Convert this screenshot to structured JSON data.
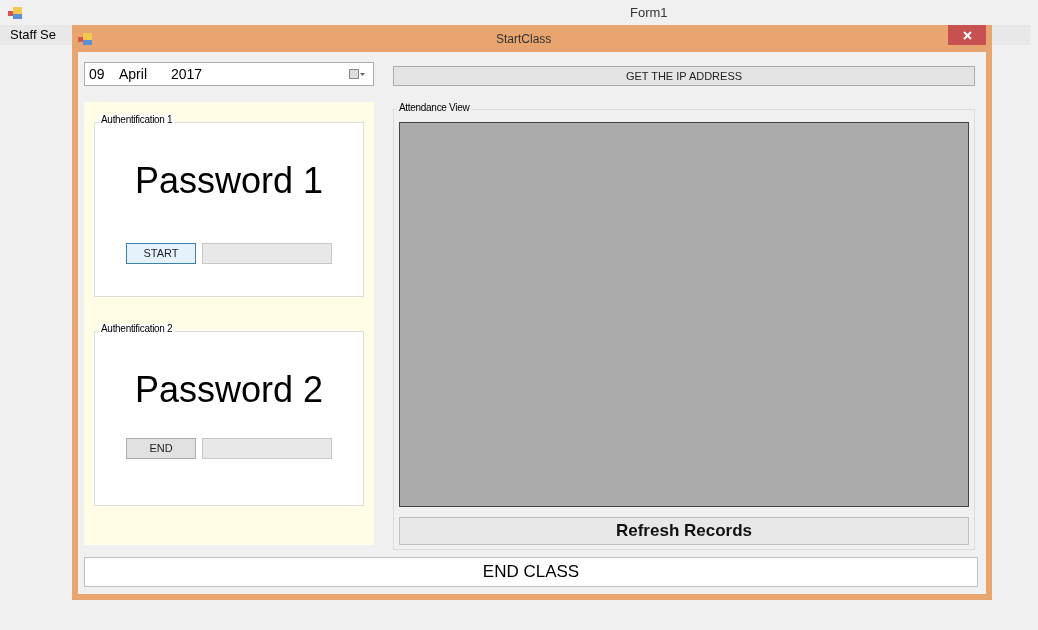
{
  "main_window": {
    "title": "Form1",
    "menu": [
      "Staff Se"
    ]
  },
  "dialog": {
    "title": "StartClass",
    "date_picker": {
      "day": "09",
      "month": "April",
      "year": "2017"
    },
    "auth_groups": [
      {
        "caption": "Authentification 1",
        "heading": "Password 1",
        "button": "START",
        "focused": true
      },
      {
        "caption": "Authentification 2",
        "heading": "Password 2",
        "button": "END",
        "focused": false
      }
    ],
    "ip_button": "GET THE IP ADDRESS",
    "attendance": {
      "caption": "Attendance View"
    },
    "refresh_button": "Refresh Records",
    "end_class_button": "END CLASS"
  }
}
